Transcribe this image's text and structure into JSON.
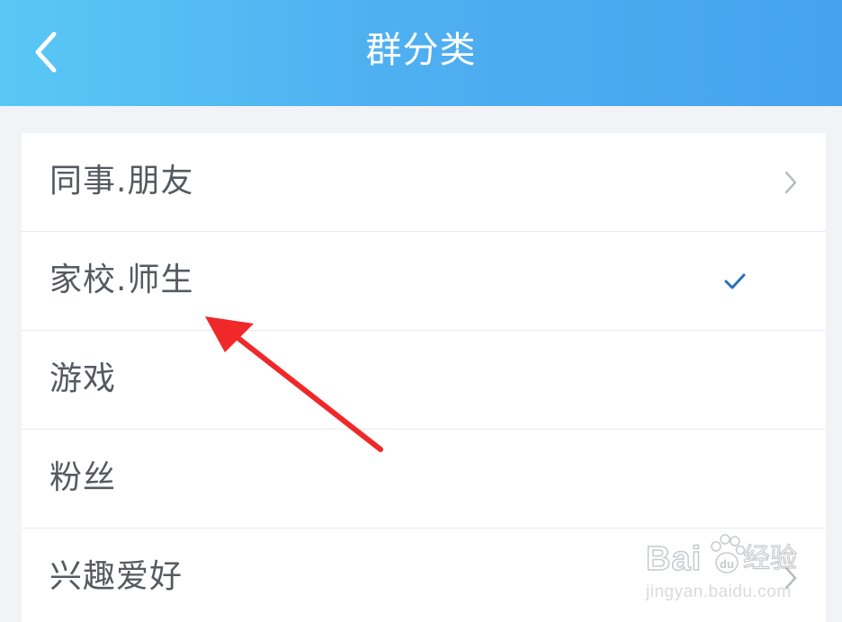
{
  "header": {
    "title": "群分类",
    "back_icon": "chevron-left-icon"
  },
  "categories": [
    {
      "label": "同事.朋友",
      "trailing": "chevron-right-icon",
      "selected": false
    },
    {
      "label": "家校.师生",
      "trailing": "checkmark-icon",
      "selected": true
    },
    {
      "label": "游戏",
      "trailing": "",
      "selected": false
    },
    {
      "label": "粉丝",
      "trailing": "",
      "selected": false
    },
    {
      "label": "兴趣爱好",
      "trailing": "chevron-right-icon",
      "selected": false
    }
  ],
  "annotation": {
    "icon": "red-arrow-icon",
    "color": "#f0282a"
  },
  "watermark": {
    "brand": "Bai",
    "brand_suffix": "经验",
    "url": "jingyan.baidu.com"
  },
  "colors": {
    "header_gradient_start": "#59c8f5",
    "header_gradient_end": "#46a2ee",
    "check_color": "#2d6fb8",
    "chevron_color": "#b8bcc2"
  }
}
